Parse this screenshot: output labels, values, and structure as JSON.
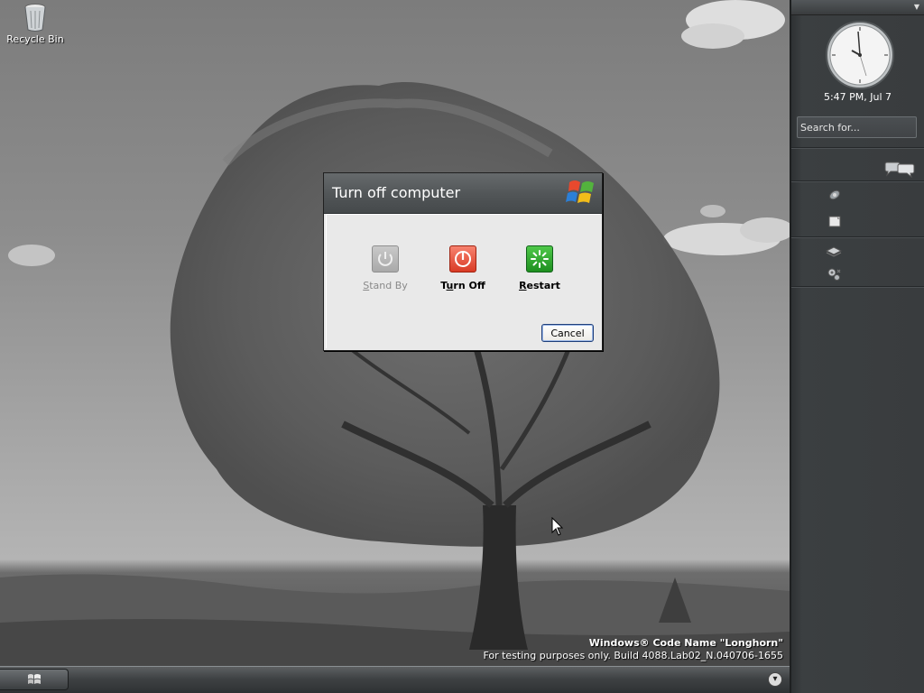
{
  "desktop": {
    "icons": [
      {
        "label": "Recycle Bin",
        "icon": "recycle-bin-icon"
      }
    ],
    "watermark": {
      "title": "Windows® Code Name \"Longhorn\"",
      "subtitle": "For testing purposes only. Build 4088.Lab02_N.040706-1655"
    }
  },
  "sidebar": {
    "clock_time": "5:47 PM, Jul 7",
    "search_placeholder": "Search for...",
    "icons": [
      "buddy-chat-icon",
      "satellite-icon",
      "note-icon",
      "stack-icon",
      "gears-icon"
    ]
  },
  "dialog": {
    "title": "Turn off computer",
    "options": [
      {
        "label": "Stand By",
        "mnemonic": "S",
        "rest": "tand By",
        "enabled": false,
        "color": "#b9b9b9",
        "icon": "standby-power-icon"
      },
      {
        "label": "Turn Off",
        "mnemonic": "u",
        "prefix": "T",
        "rest": "rn Off",
        "enabled": true,
        "color": "#e4533e",
        "icon": "power-icon"
      },
      {
        "label": "Restart",
        "mnemonic": "R",
        "rest": "estart",
        "enabled": true,
        "color": "#2fa12c",
        "icon": "restart-icon"
      }
    ],
    "cancel_label": "Cancel"
  },
  "taskbar": {
    "start_icon": "windows-flag-icon",
    "tray_icon": "chevron-down-icon"
  }
}
